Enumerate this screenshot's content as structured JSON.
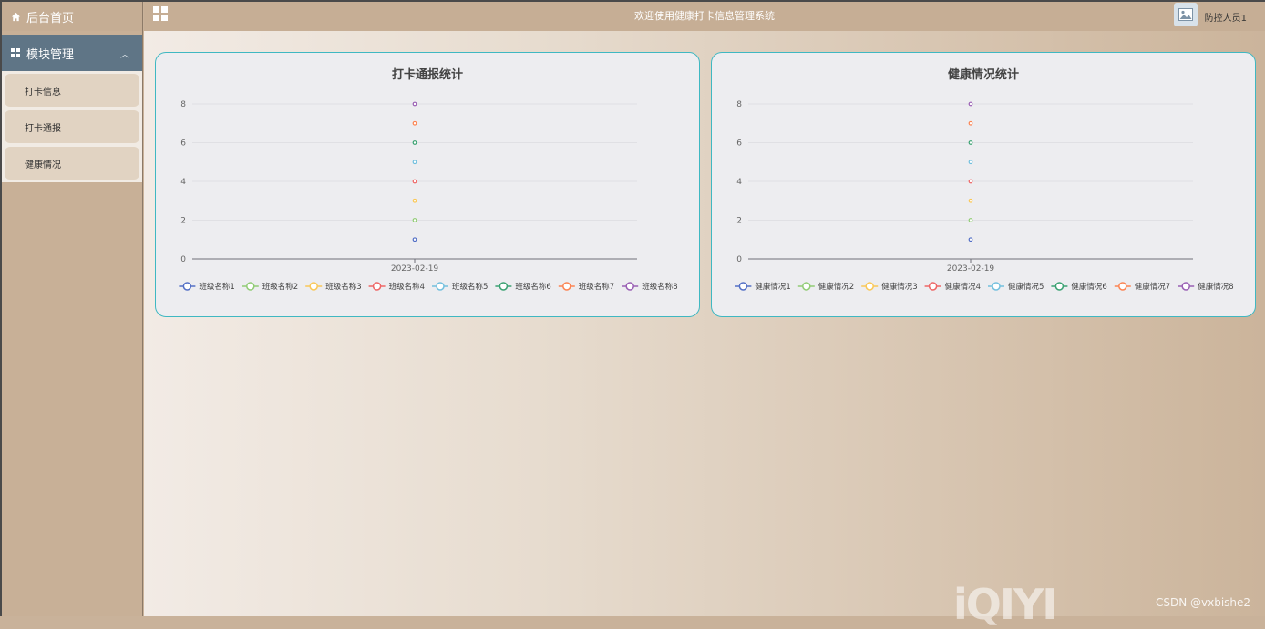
{
  "sidebar": {
    "home_label": "后台首页",
    "module_label": "模块管理",
    "items": [
      {
        "label": "打卡信息"
      },
      {
        "label": "打卡通报"
      },
      {
        "label": "健康情况"
      }
    ]
  },
  "header": {
    "title": "欢迎使用健康打卡信息管理系统",
    "user": "防控人员1"
  },
  "colors": {
    "series": [
      "#5470c6",
      "#91cc75",
      "#fac858",
      "#ee6666",
      "#73c0de",
      "#3ba272",
      "#fc8452",
      "#9a60b4"
    ],
    "card_border": "#3fb8c2"
  },
  "chart_data": [
    {
      "type": "line",
      "title": "打卡通报统计",
      "categories": [
        "2023-02-19"
      ],
      "ylim": [
        0,
        8
      ],
      "yticks": [
        0,
        2,
        4,
        6,
        8
      ],
      "series": [
        {
          "name": "班级名称1",
          "values": [
            1
          ]
        },
        {
          "name": "班级名称2",
          "values": [
            2
          ]
        },
        {
          "name": "班级名称3",
          "values": [
            3
          ]
        },
        {
          "name": "班级名称4",
          "values": [
            4
          ]
        },
        {
          "name": "班级名称5",
          "values": [
            5
          ]
        },
        {
          "name": "班级名称6",
          "values": [
            6
          ]
        },
        {
          "name": "班级名称7",
          "values": [
            7
          ]
        },
        {
          "name": "班级名称8",
          "values": [
            8
          ]
        }
      ],
      "legend": "bottom"
    },
    {
      "type": "line",
      "title": "健康情况统计",
      "categories": [
        "2023-02-19"
      ],
      "ylim": [
        0,
        8
      ],
      "yticks": [
        0,
        2,
        4,
        6,
        8
      ],
      "series": [
        {
          "name": "健康情况1",
          "values": [
            1
          ]
        },
        {
          "name": "健康情况2",
          "values": [
            2
          ]
        },
        {
          "name": "健康情况3",
          "values": [
            3
          ]
        },
        {
          "name": "健康情况4",
          "values": [
            4
          ]
        },
        {
          "name": "健康情况5",
          "values": [
            5
          ]
        },
        {
          "name": "健康情况6",
          "values": [
            6
          ]
        },
        {
          "name": "健康情况7",
          "values": [
            7
          ]
        },
        {
          "name": "健康情况8",
          "values": [
            8
          ]
        }
      ],
      "legend": "bottom"
    }
  ],
  "watermark": {
    "logo": "iQIYI",
    "credit": "CSDN @vxbishe2"
  }
}
